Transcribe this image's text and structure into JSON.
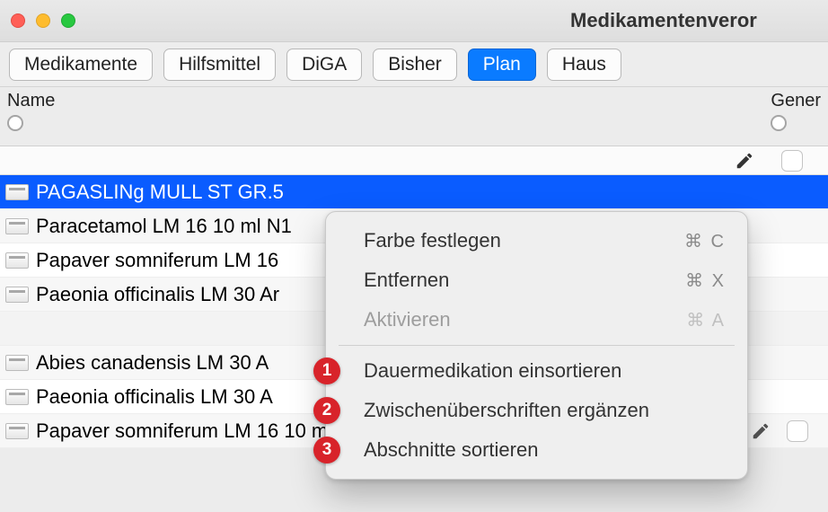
{
  "window": {
    "title": "Medikamentenveror"
  },
  "toolbar": {
    "tabs": [
      {
        "label": "Medikamente",
        "active": false
      },
      {
        "label": "Hilfsmittel",
        "active": false
      },
      {
        "label": "DiGA",
        "active": false
      },
      {
        "label": "Bisher",
        "active": false
      },
      {
        "label": "Plan",
        "active": true
      },
      {
        "label": "Haus",
        "active": false
      }
    ]
  },
  "filters": {
    "name_label": "Name",
    "gener_label": "Gener"
  },
  "list": {
    "rows": [
      {
        "text": "PAGASLINg MULL ST GR.5",
        "selected": true,
        "empty": false
      },
      {
        "text": "Paracetamol LM 16 10 ml N1",
        "selected": false,
        "empty": false
      },
      {
        "text": "Papaver somniferum LM 16",
        "selected": false,
        "empty": false
      },
      {
        "text": "Paeonia officinalis LM 30 Ar",
        "selected": false,
        "empty": false
      },
      {
        "text": "",
        "selected": false,
        "empty": true
      },
      {
        "text": "Abies canadensis LM 30 A",
        "selected": false,
        "empty": false
      },
      {
        "text": "Paeonia officinalis LM 30 A",
        "selected": false,
        "empty": false
      },
      {
        "text": "Papaver somniferum LM 16 10 ml N1",
        "selected": false,
        "empty": false
      }
    ]
  },
  "context_menu": {
    "items_top": [
      {
        "label": "Farbe festlegen",
        "shortcut": "⌘ C",
        "disabled": false
      },
      {
        "label": "Entfernen",
        "shortcut": "⌘ X",
        "disabled": false
      },
      {
        "label": "Aktivieren",
        "shortcut": "⌘ A",
        "disabled": true
      }
    ],
    "items_bottom": [
      {
        "num": "1",
        "label": "Dauermedikation einsortieren"
      },
      {
        "num": "2",
        "label": "Zwischenüberschriften ergänzen"
      },
      {
        "num": "3",
        "label": "Abschnitte sortieren"
      }
    ]
  }
}
